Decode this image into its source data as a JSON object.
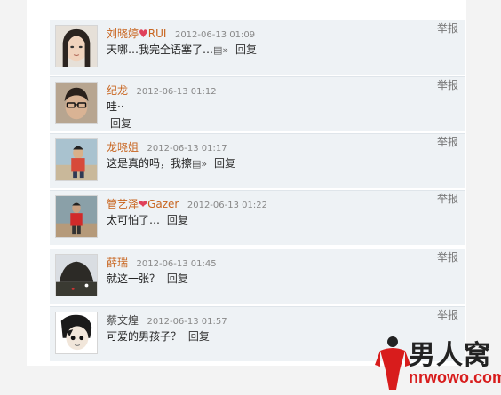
{
  "comments": [
    {
      "user": "刘晓婷",
      "user_suffix": "RUI",
      "heart": "♥",
      "time": "2012-06-13 01:09",
      "text": "天哪…我完全语塞了…",
      "emoji": "▤»",
      "reply": "回复",
      "report": "举报"
    },
    {
      "user": "纪龙",
      "time": "2012-06-13 01:12",
      "text": "哇··",
      "reply": "回复",
      "report": "举报"
    },
    {
      "user": "龙晓姐",
      "time": "2012-06-13 01:17",
      "text": "这是真的吗，我擦",
      "emoji": "▤»",
      "reply": "回复",
      "report": "举报"
    },
    {
      "user": "管艺泽",
      "user_suffix": "Gazer",
      "heart": "❤",
      "time": "2012-06-13 01:22",
      "text": "太可怕了…",
      "reply": "回复",
      "report": "举报"
    },
    {
      "user": "薛瑞",
      "time": "2012-06-13 01:45",
      "text": "就这一张？",
      "reply": "回复",
      "report": "举报"
    },
    {
      "user": "蔡文煌",
      "time": "2012-06-13 01:57",
      "text": "可爱的男孩子？",
      "reply": "回复",
      "report": "举报"
    }
  ],
  "watermark": {
    "brand": "男人窝",
    "url": "nrwowo.com"
  },
  "colors": {
    "username": "#c8641e",
    "heart": "#e0405a",
    "row_bg": "#eef2f5",
    "watermark_red": "#d81c1c"
  }
}
